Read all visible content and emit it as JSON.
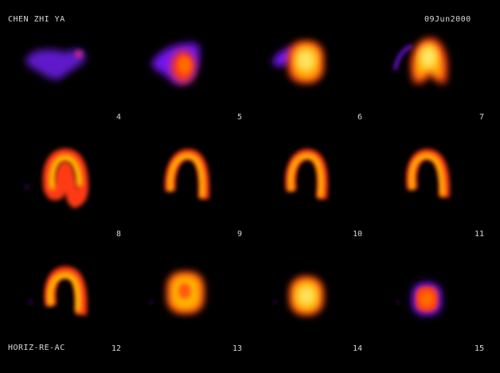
{
  "header": {
    "patient_name": "CHEN ZHI YA",
    "date": "09Jun2000",
    "view_label": "HORIZ-RE-AC"
  },
  "colormap": [
    "#000000",
    "#3a005e",
    "#7d12ff",
    "#ff2a1a",
    "#ff7a00",
    "#ffd21f",
    "#fff9a8"
  ],
  "slices": [
    {
      "label": "4"
    },
    {
      "label": "5"
    },
    {
      "label": "6"
    },
    {
      "label": "7"
    },
    {
      "label": "8"
    },
    {
      "label": "9"
    },
    {
      "label": "10"
    },
    {
      "label": "11"
    },
    {
      "label": "12"
    },
    {
      "label": "13"
    },
    {
      "label": "14"
    },
    {
      "label": "15"
    }
  ]
}
